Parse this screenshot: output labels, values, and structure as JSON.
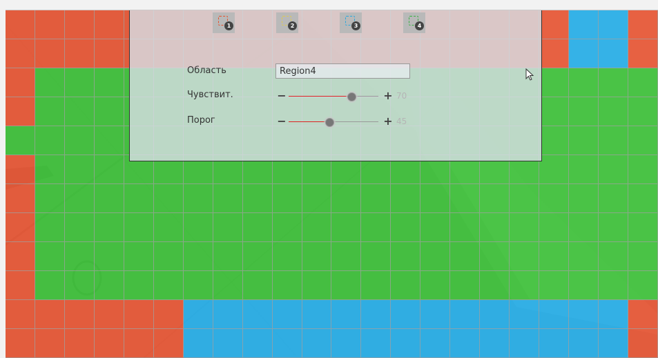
{
  "regions": [
    {
      "number": "1",
      "color": "#e8502a"
    },
    {
      "number": "2",
      "color": "#e0c850"
    },
    {
      "number": "3",
      "color": "#28a8e0"
    },
    {
      "number": "4",
      "color": "#38b040"
    }
  ],
  "area": {
    "label": "Область",
    "value": "Region4"
  },
  "sensitivity": {
    "label": "Чувствит.",
    "value": "70",
    "level": 0.7
  },
  "threshold": {
    "label": "Порог",
    "value": "45",
    "level": 0.45
  },
  "grid": {
    "rows": [
      "1111111111111111111331",
      "1111111111111111111331",
      "1444444444444444444444",
      "1444444444444444444444",
      "4444444444444444444444",
      "1444444444444444444444",
      "1444444444444444444444",
      "1444444444444444444444",
      "1444444444444444444444",
      "1444444444444444444444",
      "1111113333333333333331",
      "1111113333333333333331"
    ]
  }
}
